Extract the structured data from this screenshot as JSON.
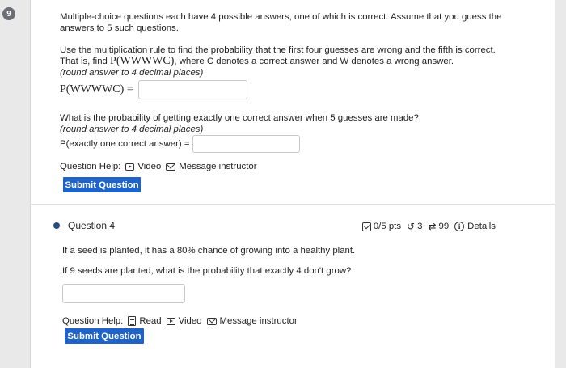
{
  "question_number_badge": "9",
  "q1": {
    "intro": "Multiple-choice questions each have 4 possible answers, one of which is correct. Assume that you guess the answers to 5 such questions.",
    "part1_text_a": "Use the multiplication rule to find the probability that the first four guesses are wrong and the fifth is correct. That is, find ",
    "part1_math": "P(WWWWC)",
    "part1_text_b": ", where C denotes a correct answer and W denotes a wrong answer.",
    "part1_rounding": "(round answer to 4 decimal places)",
    "part1_label": "P(WWWWC) =",
    "part1_value": "",
    "part2_text": "What is the probability of getting exactly one correct answer when 5 guesses are made?",
    "part2_rounding": "(round answer to 4 decimal places)",
    "part2_label": "P(exactly one correct answer) =",
    "part2_value": "",
    "help_label": "Question Help:",
    "help_video": "Video",
    "help_message": "Message instructor",
    "submit_label": "Submit Question"
  },
  "q4": {
    "title": "Question 4",
    "points": "0/5 pts",
    "retries": "3",
    "attempts": "99",
    "details": "Details",
    "text1": "If a seed is planted, it has a 80% chance of growing into a healthy plant.",
    "text2": "If 9 seeds are planted, what is the probability that exactly 4 don't grow?",
    "answer_value": "",
    "help_label": "Question Help:",
    "help_read": "Read",
    "help_video": "Video",
    "help_message": "Message instructor",
    "submit_label": "Submit Question"
  }
}
